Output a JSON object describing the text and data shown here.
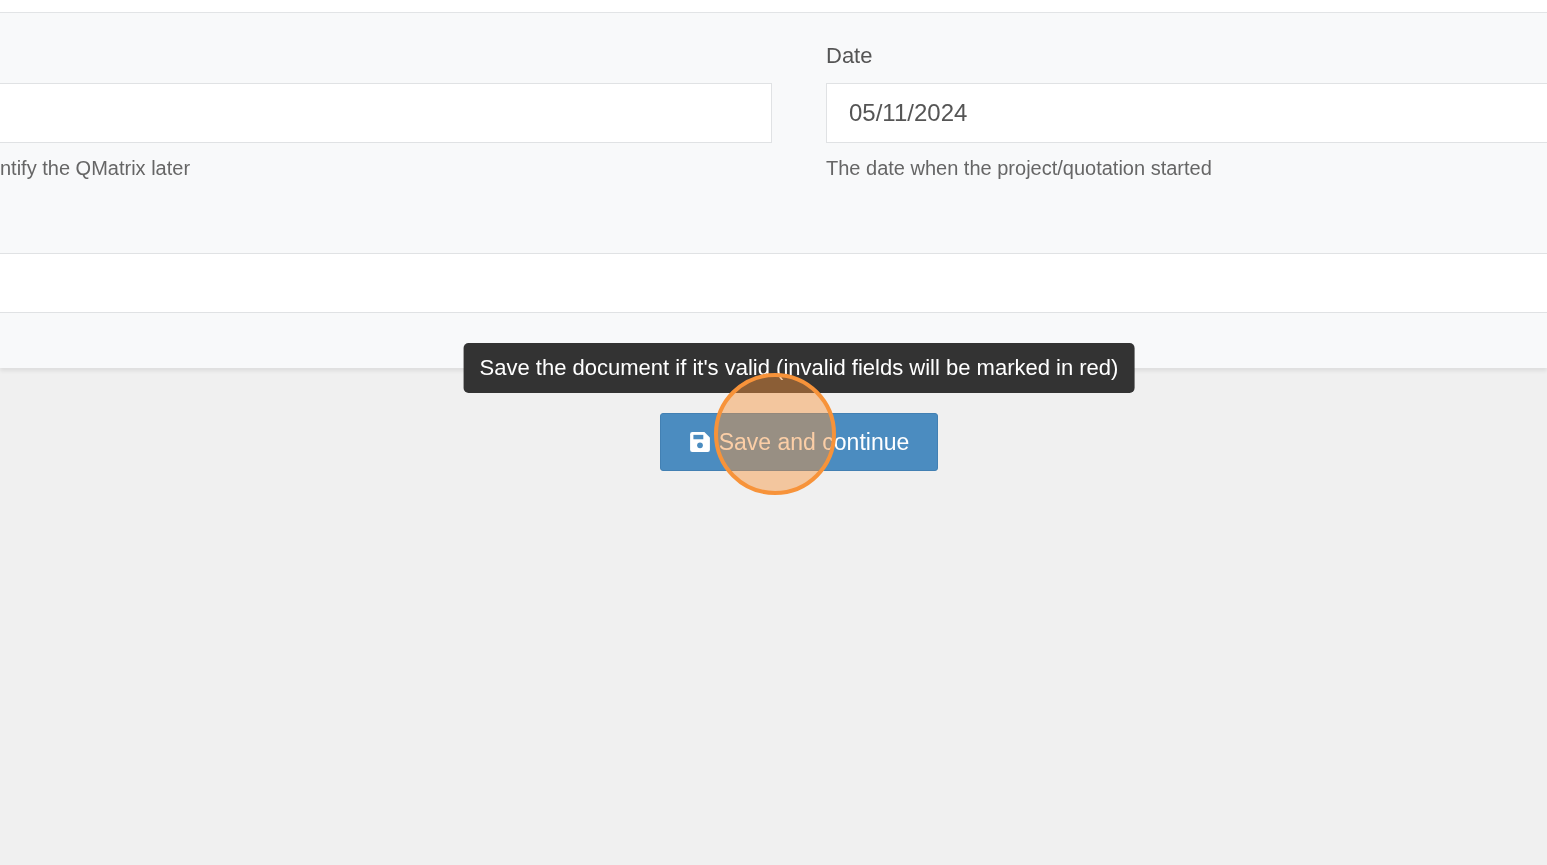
{
  "form": {
    "fields": [
      {
        "hint": "ntify the QMatrix later"
      },
      {
        "label": "Date",
        "value": "05/11/2024",
        "hint": "The date when the project/quotation started"
      }
    ]
  },
  "save_button": {
    "label": "Save and continue",
    "tooltip": "Save the document if it's valid (invalid fields will be marked in red)"
  }
}
